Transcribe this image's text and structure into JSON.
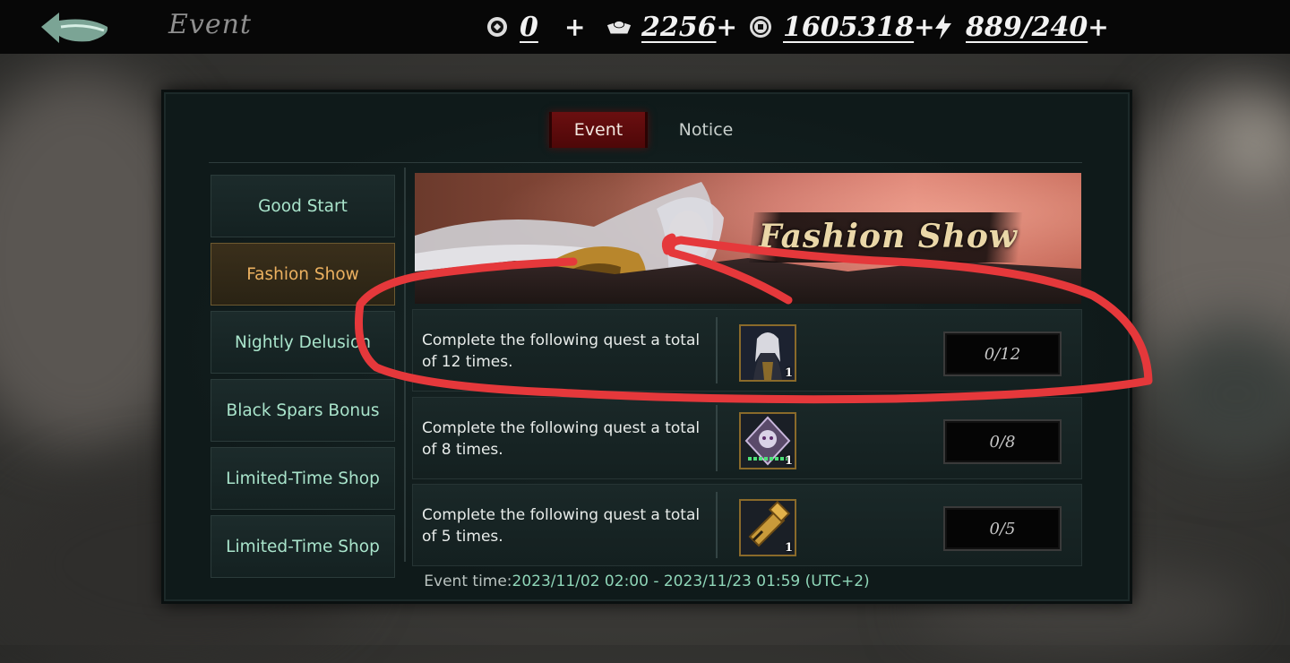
{
  "topbar": {
    "title": "Event",
    "resources": [
      {
        "icon": "coin-badge-icon",
        "value": "0",
        "plus": "+"
      },
      {
        "icon": "ingot-icon",
        "value": "2256",
        "plus": "+"
      },
      {
        "icon": "silver-coin-icon",
        "value": "1605318",
        "plus": "+"
      },
      {
        "icon": "lightning-icon",
        "value": "889/240",
        "plus": "+"
      }
    ]
  },
  "tabs": {
    "event": "Event",
    "notice": "Notice"
  },
  "sidebar": {
    "items": [
      {
        "label": "Good Start"
      },
      {
        "label": "Fashion Show"
      },
      {
        "label": "Nightly Delusion"
      },
      {
        "label": "Black Spars Bonus"
      },
      {
        "label": "Limited-Time Shop"
      },
      {
        "label": "Limited-Time Shop"
      }
    ]
  },
  "banner": {
    "title": "Fashion Show"
  },
  "quests": [
    {
      "text": "Complete the following quest a total of 12 times.",
      "reward_count": "1",
      "progress": "0/12",
      "reward_icon": "character-costume-icon"
    },
    {
      "text": "Complete the following quest a total of 8 times.",
      "reward_count": "1",
      "progress": "0/8",
      "reward_icon": "purple-gem-icon"
    },
    {
      "text": "Complete the following quest a total of 5 times.",
      "reward_count": "1",
      "progress": "0/5",
      "reward_icon": "golden-hammer-icon"
    }
  ],
  "event_time": {
    "label": "Event time:",
    "range": "2023/11/02 02:00 - 2023/11/23 01:59 (UTC+2)"
  },
  "colors": {
    "active_tab": "#6b0f10",
    "sidebar_text": "#a9e4cb",
    "sidebar_active_text": "#ecb160",
    "annotation": "#e5383b"
  }
}
